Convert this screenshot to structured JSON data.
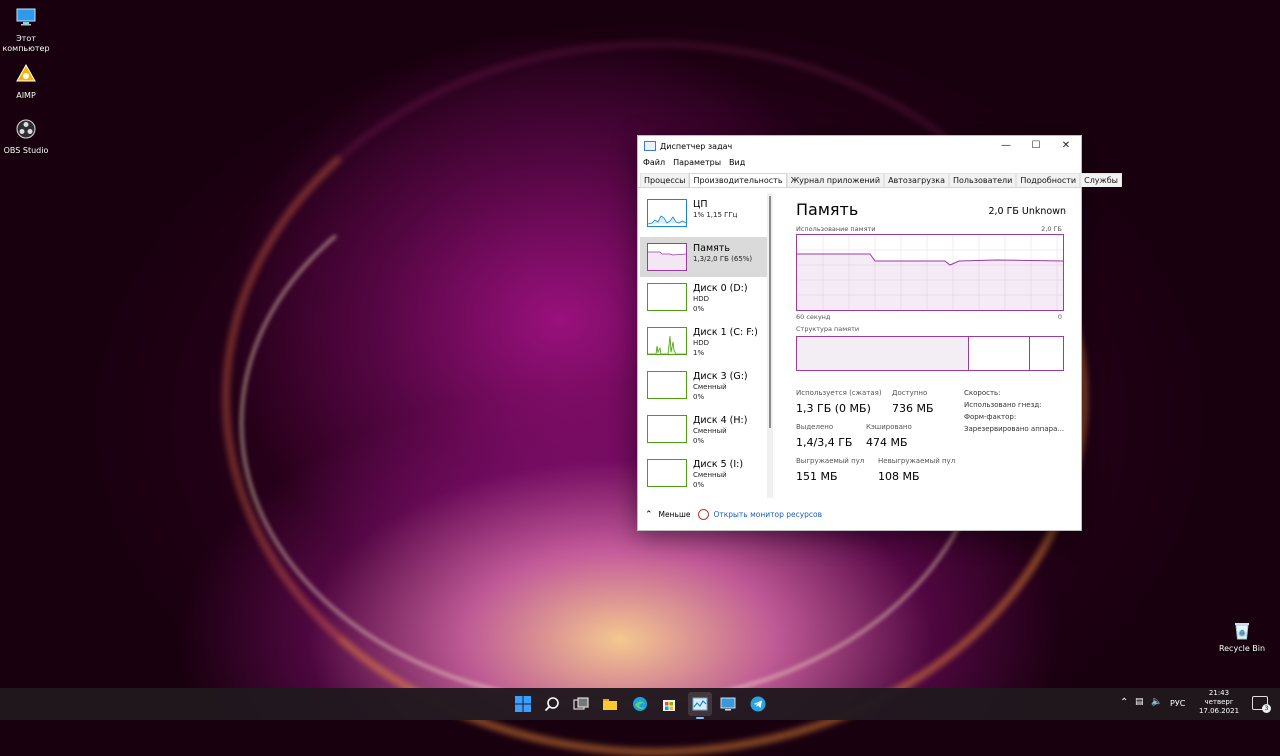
{
  "desktop": {
    "icons": [
      {
        "label": "Этот компьютер"
      },
      {
        "label": "AIMP"
      },
      {
        "label": "OBS Studio"
      }
    ],
    "recycle_bin": "Recycle Bin"
  },
  "window": {
    "title": "Диспетчер задач",
    "menu": [
      "Файл",
      "Параметры",
      "Вид"
    ],
    "tabs": [
      "Процессы",
      "Производительность",
      "Журнал приложений",
      "Автозагрузка",
      "Пользователи",
      "Подробности",
      "Службы"
    ],
    "active_tab": "Производительность",
    "sidebar": [
      {
        "name": "ЦП",
        "sub1": "1% 1,15 ГГц",
        "sub2": ""
      },
      {
        "name": "Память",
        "sub1": "1,3/2,0 ГБ (65%)",
        "sub2": ""
      },
      {
        "name": "Диск 0 (D:)",
        "sub1": "HDD",
        "sub2": "0%"
      },
      {
        "name": "Диск 1 (C: F:)",
        "sub1": "HDD",
        "sub2": "1%"
      },
      {
        "name": "Диск 3 (G:)",
        "sub1": "Сменный",
        "sub2": "0%"
      },
      {
        "name": "Диск 4 (H:)",
        "sub1": "Сменный",
        "sub2": "0%"
      },
      {
        "name": "Диск 5 (I:)",
        "sub1": "Сменный",
        "sub2": "0%"
      }
    ],
    "selected_item": "Память",
    "detail": {
      "title": "Память",
      "capacity": "2,0 ГБ Unknown",
      "usage_label": "Использование памяти",
      "usage_max": "2,0 ГБ",
      "time_left": "60 секунд",
      "time_right": "0",
      "structure_label": "Структура памяти",
      "stats": {
        "in_use_label": "Используется (сжатая)",
        "in_use": "1,3 ГБ (0 МБ)",
        "available_label": "Доступно",
        "available": "736 МБ",
        "committed_label": "Выделено",
        "committed": "1,4/3,4 ГБ",
        "cached_label": "Кэшировано",
        "cached": "474 МБ",
        "paged_label": "Выгружаемый пул",
        "paged": "151 МБ",
        "nonpaged_label": "Невыгружаемый пул",
        "nonpaged": "108 МБ",
        "speed_label": "Скорость:",
        "slots_label": "Использовано гнезд:",
        "form_label": "Форм-фактор:",
        "reserved_label": "Зарезервировано аппара..."
      }
    },
    "footer": {
      "less_label": "Меньше",
      "monitor_link": "Открыть монитор ресурсов"
    },
    "buttons": {
      "minimize": "—",
      "maximize": "☐",
      "close": "✕"
    }
  },
  "taskbar": {
    "lang": "РУС",
    "time": "21:43",
    "day": "четверг",
    "date": "17.06.2021",
    "notifications": "3"
  },
  "colors": {
    "memory_purple": "#9a3aa2",
    "cpu_blue": "#1787d4",
    "disk_green": "#4ca00f",
    "taskbar_bg": "#20181e"
  }
}
